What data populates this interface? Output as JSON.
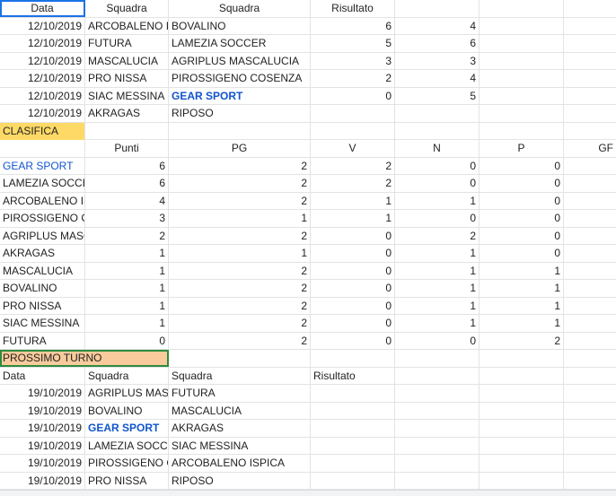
{
  "results": {
    "header": {
      "date": "Data",
      "home": "Squadra",
      "away": "Squadra",
      "score": "Risultato"
    },
    "rows": [
      {
        "date": "12/10/2019",
        "home": "ARCOBALENO ISPICA",
        "away": "BOVALINO",
        "hs": "6",
        "as": "4",
        "away_blue": false
      },
      {
        "date": "12/10/2019",
        "home": "FUTURA",
        "away": "LAMEZIA SOCCER",
        "hs": "5",
        "as": "6",
        "away_blue": false
      },
      {
        "date": "12/10/2019",
        "home": "MASCALUCIA",
        "away": "AGRIPLUS MASCALUCIA",
        "hs": "3",
        "as": "3",
        "away_blue": false
      },
      {
        "date": "12/10/2019",
        "home": "PRO NISSA",
        "away": "PIROSSIGENO COSENZA",
        "hs": "2",
        "as": "4",
        "away_blue": false
      },
      {
        "date": "12/10/2019",
        "home": "SIAC MESSINA",
        "away": "GEAR SPORT",
        "hs": "0",
        "as": "5",
        "away_blue": true
      },
      {
        "date": "12/10/2019",
        "home": "AKRAGAS",
        "away": "RIPOSO",
        "hs": "",
        "as": "",
        "away_blue": false
      }
    ]
  },
  "standings": {
    "title": "CLASIFICA",
    "header": {
      "team": "",
      "punti": "Punti",
      "pg": "PG",
      "v": "V",
      "n": "N",
      "p": "P",
      "gf": "GF"
    },
    "rows": [
      {
        "team": "GEAR SPORT",
        "punti": "6",
        "pg": "2",
        "v": "2",
        "n": "0",
        "p": "0",
        "blue": true
      },
      {
        "team": "LAMEZIA SOCCER",
        "punti": "6",
        "pg": "2",
        "v": "2",
        "n": "0",
        "p": "0",
        "blue": false
      },
      {
        "team": "ARCOBALENO ISPICA",
        "punti": "4",
        "pg": "2",
        "v": "1",
        "n": "1",
        "p": "0",
        "blue": false
      },
      {
        "team": "PIROSSIGENO COSENZA",
        "punti": "3",
        "pg": "1",
        "v": "1",
        "n": "0",
        "p": "0",
        "blue": false
      },
      {
        "team": "AGRIPLUS MASCALUCIA",
        "punti": "2",
        "pg": "2",
        "v": "0",
        "n": "2",
        "p": "0",
        "blue": false
      },
      {
        "team": "AKRAGAS",
        "punti": "1",
        "pg": "1",
        "v": "0",
        "n": "1",
        "p": "0",
        "blue": false
      },
      {
        "team": "MASCALUCIA",
        "punti": "1",
        "pg": "2",
        "v": "0",
        "n": "1",
        "p": "1",
        "blue": false
      },
      {
        "team": "BOVALINO",
        "punti": "1",
        "pg": "2",
        "v": "0",
        "n": "1",
        "p": "1",
        "blue": false
      },
      {
        "team": "PRO NISSA",
        "punti": "1",
        "pg": "2",
        "v": "0",
        "n": "1",
        "p": "1",
        "blue": false
      },
      {
        "team": "SIAC MESSINA",
        "punti": "1",
        "pg": "2",
        "v": "0",
        "n": "1",
        "p": "1",
        "blue": false
      },
      {
        "team": "FUTURA",
        "punti": "0",
        "pg": "2",
        "v": "0",
        "n": "0",
        "p": "2",
        "blue": false
      }
    ]
  },
  "next_round": {
    "title": "PROSSIMO TURNO",
    "header": {
      "date": "Data",
      "home": "Squadra",
      "away": "Squadra",
      "score": "Risultato"
    },
    "rows": [
      {
        "date": "19/10/2019",
        "home": "AGRIPLUS MASCALUCIA",
        "away": "FUTURA",
        "home_blue": false
      },
      {
        "date": "19/10/2019",
        "home": "BOVALINO",
        "away": "MASCALUCIA",
        "home_blue": false
      },
      {
        "date": "19/10/2019",
        "home": "GEAR SPORT",
        "away": "AKRAGAS",
        "home_blue": true
      },
      {
        "date": "19/10/2019",
        "home": "LAMEZIA SOCCER",
        "away": "SIAC MESSINA",
        "home_blue": false
      },
      {
        "date": "19/10/2019",
        "home": "PIROSSIGENO COSENZA",
        "away": "ARCOBALENO ISPICA",
        "home_blue": false
      },
      {
        "date": "19/10/2019",
        "home": "PRO NISSA",
        "away": "RIPOSO",
        "home_blue": false
      }
    ]
  },
  "colors": {
    "link_blue": "#1155cc",
    "clasifica_fill": "#ffd966",
    "prossimo_fill": "#f9cb9c",
    "selection": "#1a73e8"
  }
}
